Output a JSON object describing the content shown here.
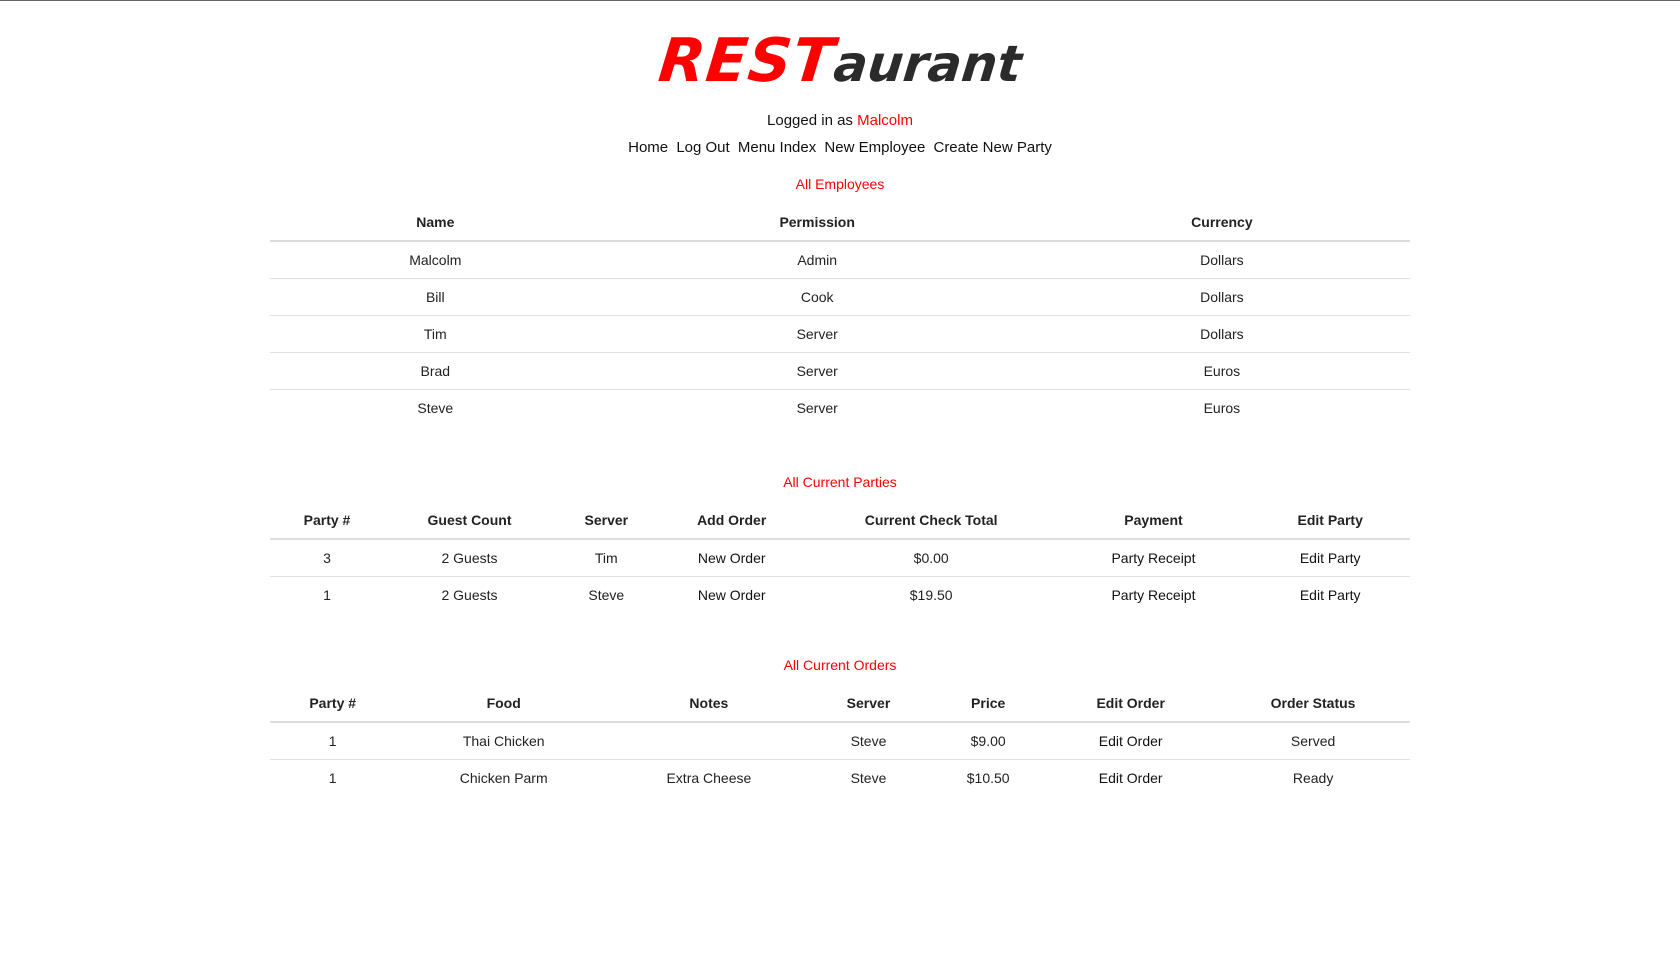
{
  "logo": {
    "part1": "REST",
    "part2": "aurant"
  },
  "session": {
    "prefix": "Logged in as",
    "user": "Malcolm"
  },
  "nav": [
    "Home",
    "Log Out",
    "Menu Index",
    "New Employee",
    "Create New Party"
  ],
  "employees": {
    "title": "All Employees",
    "headers": [
      "Name",
      "Permission",
      "Currency"
    ],
    "rows": [
      [
        "Malcolm",
        "Admin",
        "Dollars"
      ],
      [
        "Bill",
        "Cook",
        "Dollars"
      ],
      [
        "Tim",
        "Server",
        "Dollars"
      ],
      [
        "Brad",
        "Server",
        "Euros"
      ],
      [
        "Steve",
        "Server",
        "Euros"
      ]
    ]
  },
  "parties": {
    "title": "All Current Parties",
    "headers": [
      "Party #",
      "Guest Count",
      "Server",
      "Add Order",
      "Current Check Total",
      "Payment",
      "Edit Party"
    ],
    "rows": [
      [
        "3",
        "2 Guests",
        "Tim",
        "New Order",
        "$0.00",
        "Party Receipt",
        "Edit Party"
      ],
      [
        "1",
        "2 Guests",
        "Steve",
        "New Order",
        "$19.50",
        "Party Receipt",
        "Edit Party"
      ]
    ]
  },
  "orders": {
    "title": "All Current Orders",
    "headers": [
      "Party #",
      "Food",
      "Notes",
      "Server",
      "Price",
      "Edit Order",
      "Order Status"
    ],
    "rows": [
      [
        "1",
        "Thai Chicken",
        "",
        "Steve",
        "$9.00",
        "Edit Order",
        "Served"
      ],
      [
        "1",
        "Chicken Parm",
        "Extra Cheese",
        "Steve",
        "$10.50",
        "Edit Order",
        "Ready"
      ]
    ]
  },
  "colors": {
    "accent": "#ff0000",
    "text": "#222222"
  }
}
